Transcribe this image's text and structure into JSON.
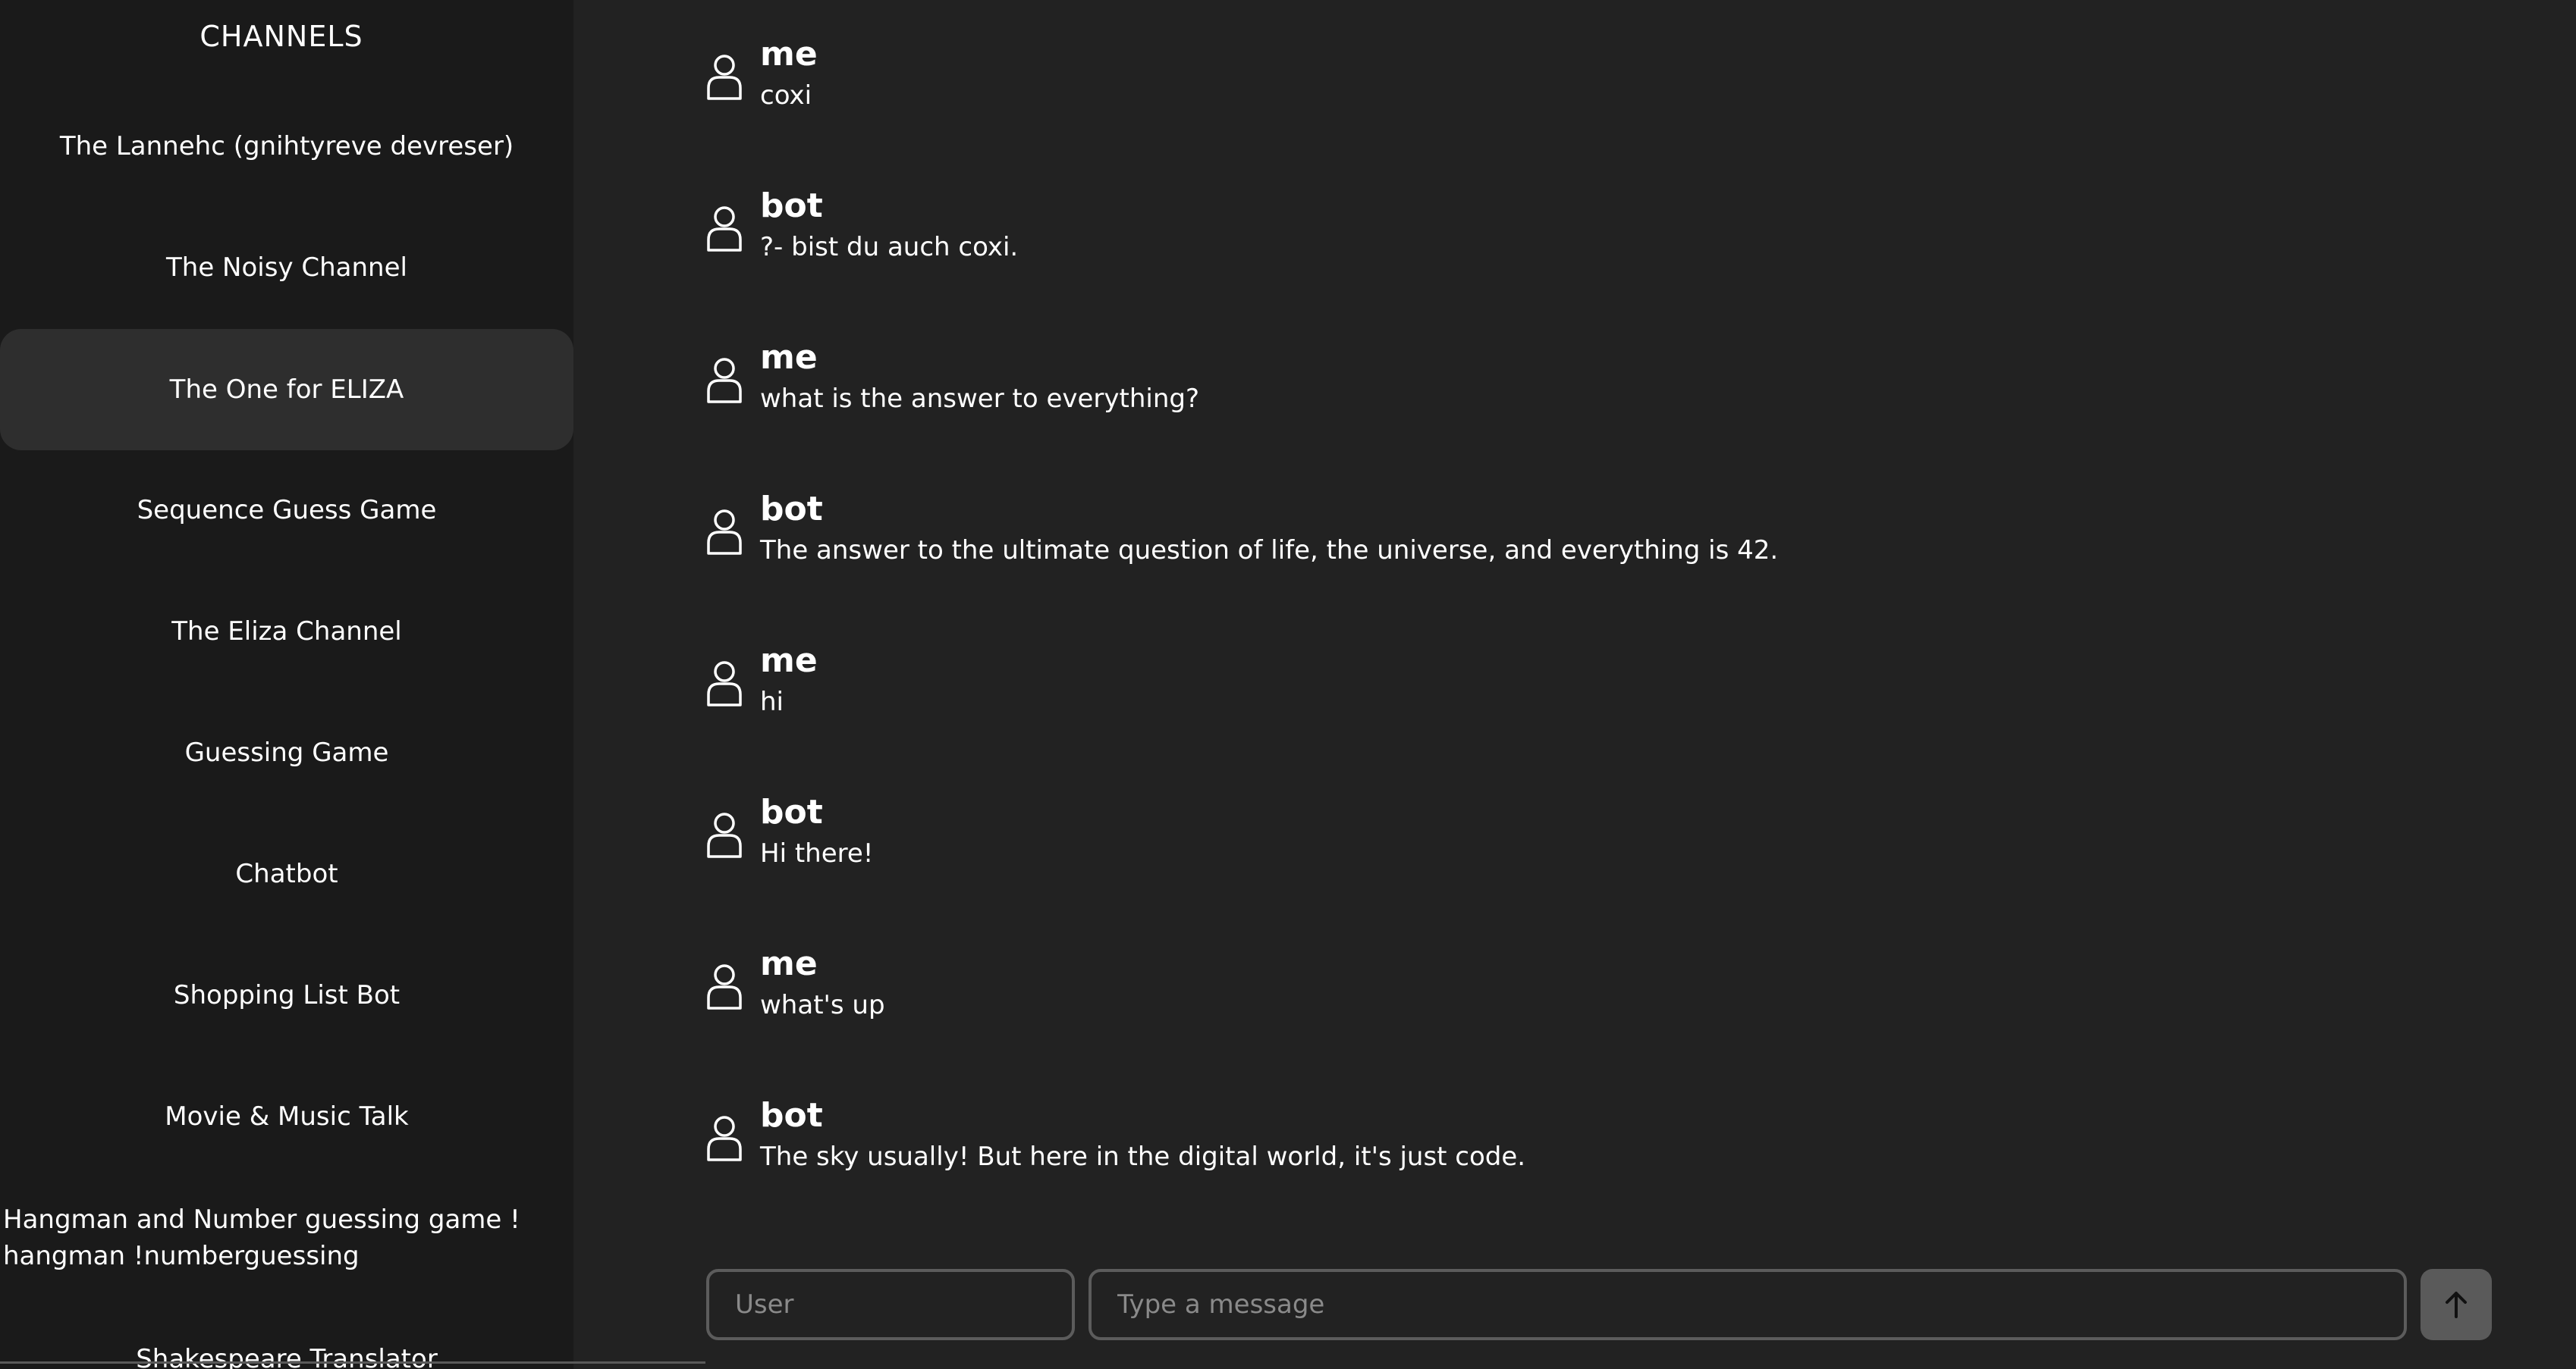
{
  "sidebar": {
    "title": "CHANNELS",
    "items": [
      {
        "label": "The Lannehc (gnihtyreve devreser)"
      },
      {
        "label": "The Noisy Channel"
      },
      {
        "label": "The One for ELIZA",
        "active": true
      },
      {
        "label": "Sequence Guess Game"
      },
      {
        "label": "The Eliza Channel"
      },
      {
        "label": "Guessing Game"
      },
      {
        "label": "Chatbot"
      },
      {
        "label": "Shopping List Bot"
      },
      {
        "label": "Movie & Music Talk"
      },
      {
        "label_line1": "Hangman and Number guessing game !",
        "label_line2": "hangman !numberguessing"
      },
      {
        "label": "Shakespeare Translator"
      }
    ]
  },
  "messages": [
    {
      "author": "me",
      "text": "coxi"
    },
    {
      "author": "bot",
      "text": "?- bist du auch coxi."
    },
    {
      "author": "me",
      "text": "what is the answer to everything?"
    },
    {
      "author": "bot",
      "text": "The answer to the ultimate question of life, the universe, and everything is 42."
    },
    {
      "author": "me",
      "text": "hi"
    },
    {
      "author": "bot",
      "text": "Hi there!"
    },
    {
      "author": "me",
      "text": "what's up"
    },
    {
      "author": "bot",
      "text": "The sky usually! But here in the digital world, it's just code."
    }
  ],
  "composer": {
    "user_placeholder": "User",
    "message_placeholder": "Type a message",
    "send_icon": "arrow-up-icon"
  },
  "colors": {
    "background": "#222222",
    "sidebar_background": "#1a1a1a",
    "active_channel": "#2e2e2e",
    "send_button": "#5a5a5a"
  }
}
